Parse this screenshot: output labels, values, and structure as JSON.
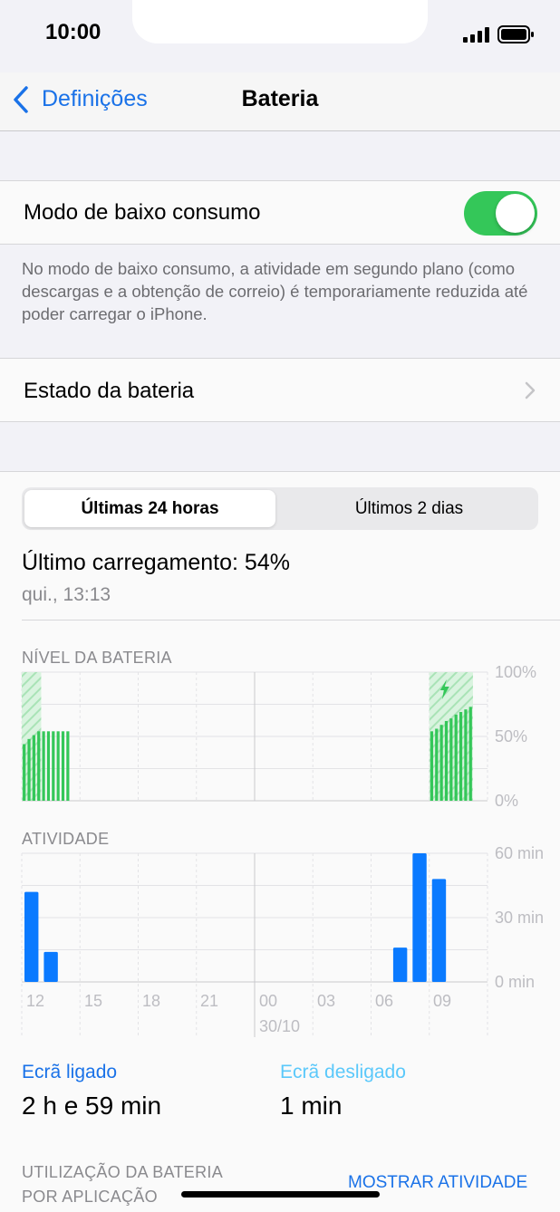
{
  "status_bar": {
    "time": "10:00"
  },
  "nav": {
    "back_label": "Definições",
    "title": "Bateria"
  },
  "low_power": {
    "label": "Modo de baixo consumo",
    "enabled": true,
    "note": "No modo de baixo consumo, a atividade em segundo plano (como descargas e a obtenção de correio) é temporariamente reduzida até poder carregar o iPhone."
  },
  "battery_health": {
    "label": "Estado da bateria"
  },
  "segments": {
    "active": "Últimas 24 horas",
    "other": "Últimos 2 dias"
  },
  "last_charge": {
    "title": "Último carregamento: 54%",
    "subtitle": "qui., 13:13"
  },
  "colors": {
    "accent": "#1a72e8",
    "battery_green": "#34c759",
    "activity_blue": "#0a7aff",
    "screen_off": "#5ac8fa"
  },
  "chart_data": [
    {
      "type": "bar",
      "title": "NÍVEL DA BATERIA",
      "y_ticks": [
        "100%",
        "50%",
        "0%"
      ],
      "ylim": [
        0,
        100
      ],
      "battery_bars": [
        {
          "slot": 0,
          "value": 44,
          "charging": true
        },
        {
          "slot": 1,
          "value": 48,
          "charging": true
        },
        {
          "slot": 2,
          "value": 51,
          "charging": true
        },
        {
          "slot": 3,
          "value": 54,
          "charging": true
        },
        {
          "slot": 4,
          "value": 54,
          "charging": false
        },
        {
          "slot": 5,
          "value": 54,
          "charging": false
        },
        {
          "slot": 6,
          "value": 54,
          "charging": false
        },
        {
          "slot": 7,
          "value": 54,
          "charging": false
        },
        {
          "slot": 8,
          "value": 54,
          "charging": false
        },
        {
          "slot": 9,
          "value": 54,
          "charging": false
        },
        {
          "slot": 84,
          "value": 54,
          "charging": true
        },
        {
          "slot": 85,
          "value": 56,
          "charging": true
        },
        {
          "slot": 86,
          "value": 59,
          "charging": true
        },
        {
          "slot": 87,
          "value": 62,
          "charging": true
        },
        {
          "slot": 88,
          "value": 64,
          "charging": true
        },
        {
          "slot": 89,
          "value": 67,
          "charging": true
        },
        {
          "slot": 90,
          "value": 69,
          "charging": true
        },
        {
          "slot": 91,
          "value": 71,
          "charging": true
        },
        {
          "slot": 92,
          "value": 73,
          "charging": true
        }
      ],
      "total_slots": 96
    },
    {
      "type": "bar",
      "title": "ATIVIDADE",
      "y_ticks": [
        "60 min",
        "30 min",
        "0 min"
      ],
      "ylim": [
        0,
        60
      ],
      "categories": [
        "12",
        "15",
        "18",
        "21",
        "00",
        "03",
        "06",
        "09"
      ],
      "date_label": "30/10",
      "activity_bars": [
        {
          "hour": 12,
          "value": 42
        },
        {
          "hour": 13,
          "value": 14
        },
        {
          "hour": 7,
          "value": 16,
          "day": 2
        },
        {
          "hour": 8,
          "value": 60,
          "day": 2
        },
        {
          "hour": 9,
          "value": 48,
          "day": 2
        }
      ]
    }
  ],
  "screen_stats": {
    "on_label": "Ecrã ligado",
    "on_value": "2 h e 59 min",
    "off_label": "Ecrã desligado",
    "off_value": "1 min"
  },
  "usage": {
    "title_line1": "UTILIZAÇÃO DA BATERIA",
    "title_line2": "POR APLICAÇÃO",
    "show_activity": "MOSTRAR ATIVIDADE"
  }
}
